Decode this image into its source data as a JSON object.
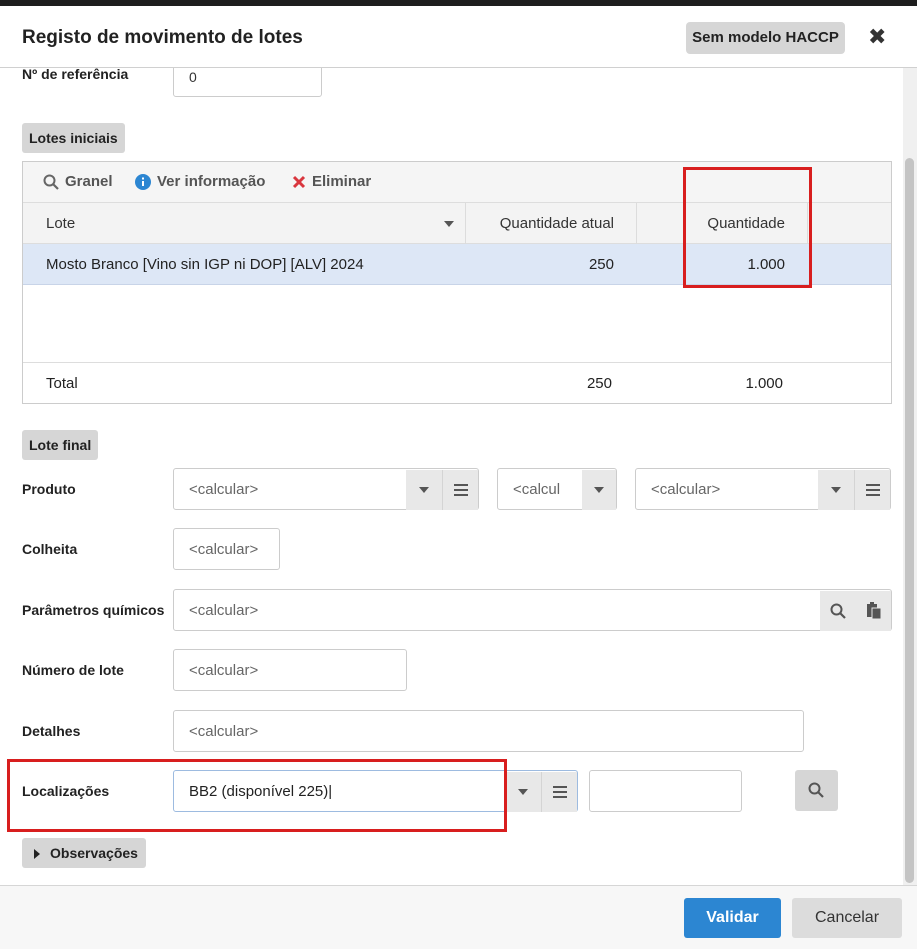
{
  "dialog": {
    "title": "Registo de movimento de lotes",
    "haccp_button": "Sem modelo HACCP",
    "close_glyph": "✖"
  },
  "reference": {
    "label": "Nº de referência",
    "value": "0"
  },
  "initial_lots": {
    "section_label": "Lotes iniciais",
    "toolbar": {
      "bulk": "Granel",
      "info": "Ver informação",
      "delete": "Eliminar"
    },
    "columns": {
      "lot": "Lote",
      "current_qty": "Quantidade atual",
      "qty": "Quantidade"
    },
    "rows": [
      {
        "lot": "Mosto Branco [Vino sin IGP ni DOP] [ALV] 2024",
        "current_qty": "250",
        "qty": "1.000"
      }
    ],
    "total": {
      "label": "Total",
      "current_qty": "250",
      "qty": "1.000"
    }
  },
  "final_lot": {
    "section_label": "Lote final",
    "product": {
      "label": "Produto",
      "value1": "<calcular>",
      "value2": "<calcul",
      "value3": "<calcular>"
    },
    "harvest": {
      "label": "Colheita",
      "value": "<calcular>"
    },
    "chem_params": {
      "label": "Parâmetros químicos",
      "value": "<calcular>"
    },
    "lot_number": {
      "label": "Número de lote",
      "value": "<calcular>"
    },
    "details": {
      "label": "Detalhes",
      "value": "<calcular>"
    },
    "locations": {
      "label": "Localizações",
      "value": "BB2 (disponível 225)",
      "extra_value": ""
    }
  },
  "observations": {
    "label": "Observações"
  },
  "footer": {
    "validate": "Validar",
    "cancel": "Cancelar"
  },
  "colors": {
    "primary": "#2c86d2",
    "highlight_row": "#dde7f6",
    "annotation_red": "#d81e1e",
    "info_blue": "#2c86d2",
    "delete_red": "#d9363e"
  }
}
